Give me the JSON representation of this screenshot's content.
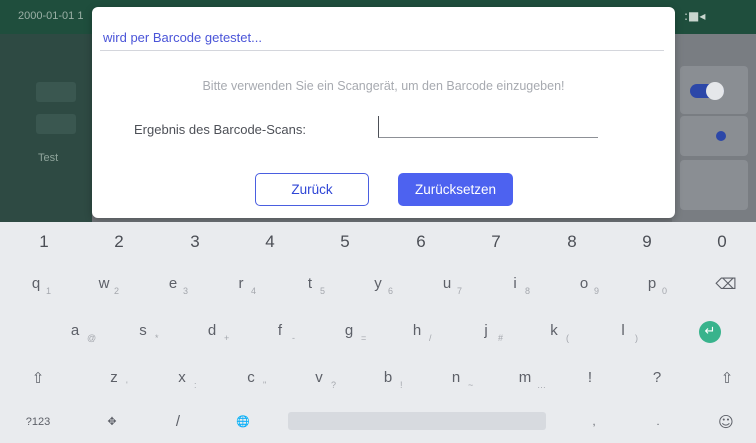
{
  "status_bar": {
    "time": "2000-01-01 1",
    "battery_icon": "battery-icon"
  },
  "side": {
    "label": "Test"
  },
  "dialog": {
    "title": "wird per Barcode getestet...",
    "message": "Bitte verwenden Sie ein Scangerät, um den Barcode einzugeben!",
    "result_label": "Ergebnis des Barcode-Scans:",
    "result_value": "",
    "back_label": "Zurück",
    "reset_label": "Zurücksetzen"
  },
  "keyboard": {
    "numbers": [
      "1",
      "2",
      "3",
      "4",
      "5",
      "6",
      "7",
      "8",
      "9",
      "0"
    ],
    "row1": [
      {
        "m": "q",
        "h": "1"
      },
      {
        "m": "w",
        "h": "2"
      },
      {
        "m": "e",
        "h": "3"
      },
      {
        "m": "r",
        "h": "4"
      },
      {
        "m": "t",
        "h": "5"
      },
      {
        "m": "y",
        "h": "6"
      },
      {
        "m": "u",
        "h": "7"
      },
      {
        "m": "i",
        "h": "8"
      },
      {
        "m": "o",
        "h": "9"
      },
      {
        "m": "p",
        "h": "0"
      },
      {
        "m": "⌫",
        "h": ""
      }
    ],
    "row2": [
      {
        "m": "a",
        "h": "@"
      },
      {
        "m": "s",
        "h": "*"
      },
      {
        "m": "d",
        "h": "+"
      },
      {
        "m": "f",
        "h": "-"
      },
      {
        "m": "g",
        "h": "="
      },
      {
        "m": "h",
        "h": "/"
      },
      {
        "m": "j",
        "h": "#"
      },
      {
        "m": "k",
        "h": "("
      },
      {
        "m": "l",
        "h": ")"
      },
      {
        "m": "↵",
        "h": ""
      }
    ],
    "row3": [
      {
        "m": "⇧",
        "h": ""
      },
      {
        "m": "z",
        "h": "'"
      },
      {
        "m": "x",
        "h": ":"
      },
      {
        "m": "c",
        "h": "\""
      },
      {
        "m": "v",
        "h": "?"
      },
      {
        "m": "b",
        "h": "!"
      },
      {
        "m": "n",
        "h": "~"
      },
      {
        "m": "m",
        "h": "…"
      },
      {
        "m": "!",
        "h": ""
      },
      {
        "m": "?",
        "h": ""
      },
      {
        "m": "⇧",
        "h": ""
      }
    ],
    "row4": [
      {
        "m": "?123"
      },
      {
        "m": "✥"
      },
      {
        "m": "/"
      },
      {
        "m": "🌐"
      },
      {
        "m": ""
      },
      {
        "m": ","
      },
      {
        "m": "."
      },
      {
        "m": "☺"
      }
    ]
  }
}
